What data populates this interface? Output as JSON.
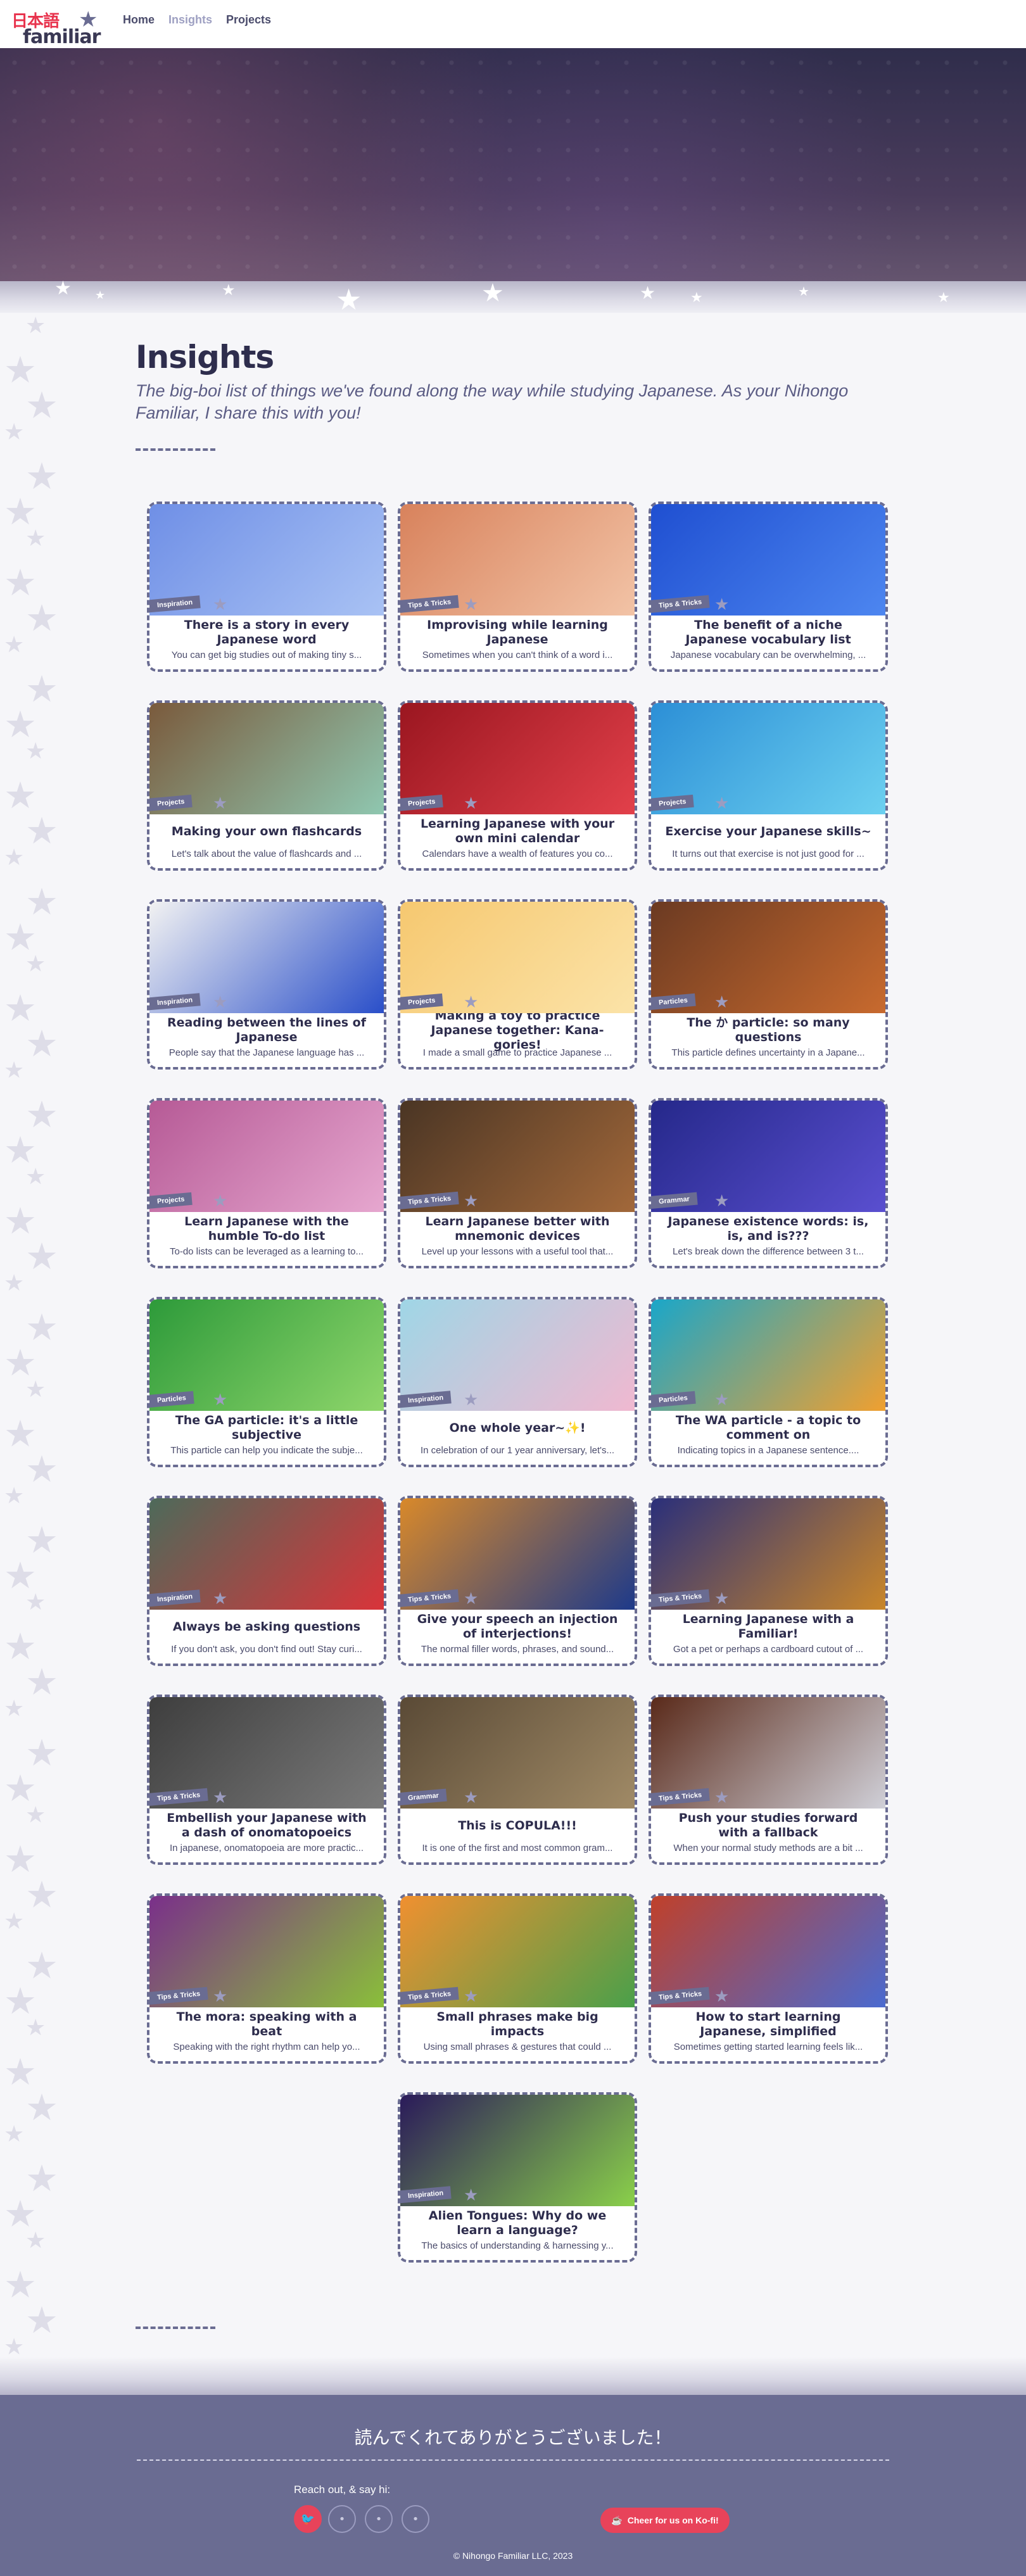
{
  "header": {
    "logo_jp": "日本語",
    "logo_en": "familiar",
    "nav": [
      {
        "label": "Home",
        "active": false
      },
      {
        "label": "Insights",
        "active": true
      },
      {
        "label": "Projects",
        "active": false
      }
    ]
  },
  "page": {
    "title": "Insights",
    "subtitle": "The big-boi list of things we've found along the way while studying Japanese. As your Nihongo Familiar, I share this with you!"
  },
  "cards": [
    {
      "tag": "Inspiration",
      "title": "There is a story in every Japanese word",
      "desc": "You can get big studies out of making tiny s...",
      "colors": [
        "#6f8fe6",
        "#a9c2f4"
      ]
    },
    {
      "tag": "Tips & Tricks",
      "title": "Improvising while learning Japanese",
      "desc": "Sometimes when you can't think of a word i...",
      "colors": [
        "#d8825c",
        "#f2c3a6"
      ]
    },
    {
      "tag": "Tips & Tricks",
      "title": "The benefit of a niche Japanese vocabulary list",
      "desc": "Japanese vocabulary can be overwhelming, ...",
      "colors": [
        "#1f4fd1",
        "#4d86f0"
      ]
    },
    {
      "tag": "Projects",
      "title": "Making your own flashcards",
      "desc": "Let's talk about the value of flashcards and ...",
      "colors": [
        "#7a5a3c",
        "#8fc7b0"
      ]
    },
    {
      "tag": "Projects",
      "title": "Learning Japanese with your own mini calendar",
      "desc": "Calendars have a wealth of features you co...",
      "colors": [
        "#9a1620",
        "#e2404a"
      ]
    },
    {
      "tag": "Projects",
      "title": "Exercise your Japanese skills~",
      "desc": "It turns out that exercise is not just good for ...",
      "colors": [
        "#2c8fd6",
        "#6cd0f0"
      ]
    },
    {
      "tag": "Inspiration",
      "title": "Reading between the lines of Japanese",
      "desc": "People say that the Japanese language has ...",
      "colors": [
        "#f2f2f2",
        "#2a4fc9"
      ]
    },
    {
      "tag": "Projects",
      "title": "Making a toy to practice Japanese together: Kana-gories!",
      "desc": "I made a small game to practice Japanese ...",
      "colors": [
        "#f6c870",
        "#fbe3a8"
      ]
    },
    {
      "tag": "Particles",
      "title": "The か particle: so many questions",
      "desc": "This particle defines uncertainty in a Japane...",
      "colors": [
        "#6b3a22",
        "#c86a2e"
      ]
    },
    {
      "tag": "Projects",
      "title": "Learn Japanese with the humble To-do list",
      "desc": "To-do lists can be leveraged as a learning to...",
      "colors": [
        "#b65a96",
        "#e6a7cf"
      ]
    },
    {
      "tag": "Tips & Tricks",
      "title": "Learn Japanese better with mnemonic devices",
      "desc": "Level up your lessons with a useful tool that...",
      "colors": [
        "#4a3524",
        "#a2683a"
      ]
    },
    {
      "tag": "Grammar",
      "title": "Japanese existence words: is, is, and is???",
      "desc": "Let's break down the difference between 3 t...",
      "colors": [
        "#25288a",
        "#5a4fd0"
      ]
    },
    {
      "tag": "Particles",
      "title": "The GA particle: it's a little subjective",
      "desc": "This particle can help you indicate the subje...",
      "colors": [
        "#2d9a3a",
        "#8fd66b"
      ]
    },
    {
      "tag": "Inspiration",
      "title": "One whole year~✨!",
      "desc": "In celebration of our 1 year anniversary, let's...",
      "colors": [
        "#9fd6e6",
        "#f0b8d0"
      ]
    },
    {
      "tag": "Particles",
      "title": "The WA particle - a topic to comment on",
      "desc": "Indicating topics in a Japanese sentence....",
      "colors": [
        "#1aa6c9",
        "#f0a030"
      ]
    },
    {
      "tag": "Inspiration",
      "title": "Always be asking questions",
      "desc": "If you don't ask, you don't find out! Stay curi...",
      "colors": [
        "#4d6a5a",
        "#d9343a"
      ]
    },
    {
      "tag": "Tips & Tricks",
      "title": "Give your speech an injection of interjections!",
      "desc": "The normal filler words, phrases, and sound...",
      "colors": [
        "#d9892a",
        "#1e3a8a"
      ]
    },
    {
      "tag": "Tips & Tricks",
      "title": "Learning Japanese with a Familiar!",
      "desc": "Got a pet or perhaps a cardboard cutout of ...",
      "colors": [
        "#2a2f7a",
        "#c9862a"
      ]
    },
    {
      "tag": "Tips & Tricks",
      "title": "Embellish your Japanese with a dash of onomatopoeics",
      "desc": "In japanese, onomatopoeia are more practic...",
      "colors": [
        "#3e3e3e",
        "#7a7a7a"
      ]
    },
    {
      "tag": "Grammar",
      "title": "This is COPULA!!!",
      "desc": "It is one of the first and most common gram...",
      "colors": [
        "#5a4a36",
        "#a08a66"
      ]
    },
    {
      "tag": "Tips & Tricks",
      "title": "Push your studies forward with a fallback",
      "desc": "When your normal study methods are a bit ...",
      "colors": [
        "#5a2a1a",
        "#d0d0d8"
      ]
    },
    {
      "tag": "Tips & Tricks",
      "title": "The mora: speaking with a beat",
      "desc": "Speaking with the right rhythm can help yo...",
      "colors": [
        "#7a2f8a",
        "#8abf3a"
      ]
    },
    {
      "tag": "Tips & Tricks",
      "title": "Small phrases make big impacts",
      "desc": "Using small phrases & gestures that could ...",
      "colors": [
        "#f09030",
        "#4aa04a"
      ]
    },
    {
      "tag": "Tips & Tricks",
      "title": "How to start learning Japanese, simplified",
      "desc": "Sometimes getting started learning feels lik...",
      "colors": [
        "#c0402a",
        "#4a6ad0"
      ]
    },
    {
      "tag": "Inspiration",
      "title": "Alien Tongues: Why do we learn a language?",
      "desc": "The basics of understanding & harnessing y...",
      "colors": [
        "#2a1a5a",
        "#8ad04a"
      ]
    }
  ],
  "footer": {
    "thanks": "読んでくれてありがとうございました！",
    "reach": "Reach out, & say hi:",
    "kofi": "Cheer for us on Ko-fi!",
    "copyright": "© Nihongo Familiar LLC, 2023"
  }
}
